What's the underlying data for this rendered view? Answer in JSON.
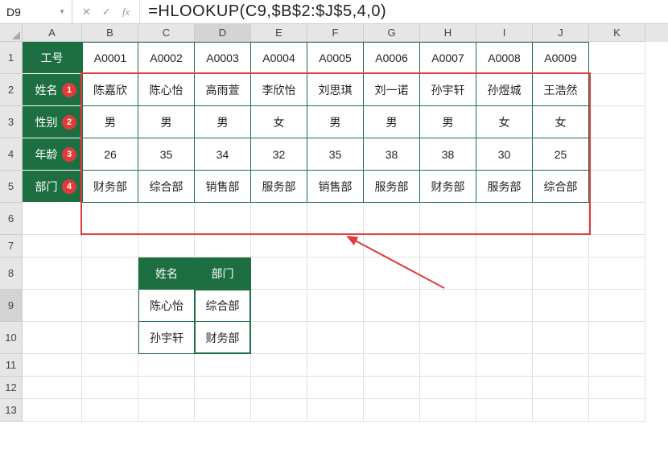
{
  "name_box": "D9",
  "formula": "=HLOOKUP(C9,$B$2:$J$5,4,0)",
  "col_letters": [
    "A",
    "B",
    "C",
    "D",
    "E",
    "F",
    "G",
    "H",
    "I",
    "J",
    "K"
  ],
  "row_numbers": [
    "1",
    "2",
    "3",
    "4",
    "5",
    "6",
    "7",
    "8",
    "9",
    "10",
    "11",
    "12",
    "13"
  ],
  "headers": {
    "r1": "工号",
    "r2": "姓名",
    "r3": "性别",
    "r4": "年龄",
    "r5": "部门"
  },
  "badges": {
    "r2": "1",
    "r3": "2",
    "r4": "3",
    "r5": "4"
  },
  "ids": [
    "A0001",
    "A0002",
    "A0003",
    "A0004",
    "A0005",
    "A0006",
    "A0007",
    "A0008",
    "A0009"
  ],
  "names": [
    "陈嘉欣",
    "陈心怡",
    "高雨萱",
    "李欣怡",
    "刘思琪",
    "刘一诺",
    "孙宇轩",
    "孙煜城",
    "王浩然"
  ],
  "sex": [
    "男",
    "男",
    "男",
    "女",
    "男",
    "男",
    "男",
    "女",
    "女"
  ],
  "age": [
    "26",
    "35",
    "34",
    "32",
    "35",
    "38",
    "38",
    "30",
    "25"
  ],
  "dept": [
    "财务部",
    "综合部",
    "销售部",
    "服务部",
    "销售部",
    "服务部",
    "财务部",
    "服务部",
    "综合部"
  ],
  "lookup": {
    "hdr_name": "姓名",
    "hdr_dept": "部门",
    "r1_name": "陈心怡",
    "r1_dept": "综合部",
    "r2_name": "孙宇轩",
    "r2_dept": "财务部"
  },
  "chart_data": {
    "type": "table",
    "title": "HLOOKUP example",
    "columns": [
      "A0001",
      "A0002",
      "A0003",
      "A0004",
      "A0005",
      "A0006",
      "A0007",
      "A0008",
      "A0009"
    ],
    "rows": [
      {
        "label": "姓名",
        "values": [
          "陈嘉欣",
          "陈心怡",
          "高雨萱",
          "李欣怡",
          "刘思琪",
          "刘一诺",
          "孙宇轩",
          "孙煜城",
          "王浩然"
        ]
      },
      {
        "label": "性别",
        "values": [
          "男",
          "男",
          "男",
          "女",
          "男",
          "男",
          "男",
          "女",
          "女"
        ]
      },
      {
        "label": "年龄",
        "values": [
          26,
          35,
          34,
          32,
          35,
          38,
          38,
          30,
          25
        ]
      },
      {
        "label": "部门",
        "values": [
          "财务部",
          "综合部",
          "销售部",
          "服务部",
          "销售部",
          "服务部",
          "财务部",
          "服务部",
          "综合部"
        ]
      }
    ],
    "lookup_result": [
      {
        "姓名": "陈心怡",
        "部门": "综合部"
      },
      {
        "姓名": "孙宇轩",
        "部门": "财务部"
      }
    ]
  }
}
